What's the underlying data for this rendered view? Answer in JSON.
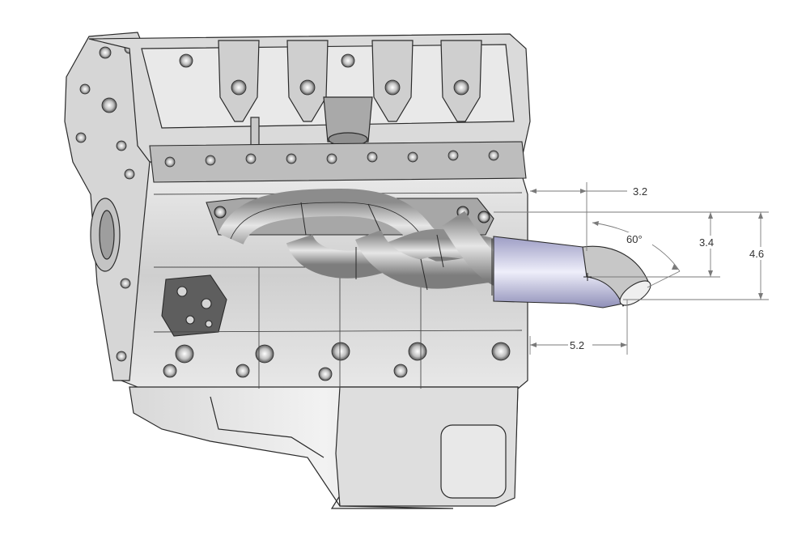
{
  "drawing": {
    "dimensions": {
      "top_offset": "3.2",
      "angle": "60°",
      "inner_height": "3.4",
      "outer_height": "4.6",
      "bottom_offset": "5.2"
    },
    "colors": {
      "engine_light": "#e4e4e4",
      "engine_mid": "#bdbdbd",
      "engine_dark": "#6f6f6f",
      "outline": "#2a2a2a",
      "pipe_light": "#dcdcdc",
      "pipe_dark": "#8a8a8a",
      "collector": "#c9c9e6",
      "dimension_line": "#7a7a7a"
    }
  }
}
